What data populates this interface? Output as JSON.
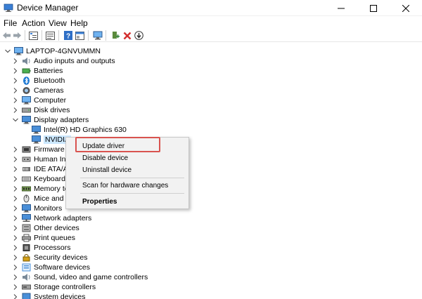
{
  "window": {
    "title": "Device Manager",
    "controls": {
      "minimize": "minimize-icon",
      "maximize": "maximize-icon",
      "close": "close-icon"
    }
  },
  "menu": {
    "items": [
      {
        "label": "File"
      },
      {
        "label": "Action"
      },
      {
        "label": "View"
      },
      {
        "label": "Help"
      }
    ]
  },
  "toolbar": {
    "buttons": [
      "back-arrow-icon",
      "forward-arrow-icon",
      "device-tree-icon",
      "properties-icon",
      "help-icon",
      "properties-sheet-icon",
      "monitor-scan-icon",
      "add-driver-icon",
      "remove-device-icon",
      "update-driver-icon"
    ]
  },
  "tree": {
    "root": "LAPTOP-4GNVUMMN",
    "categories": [
      {
        "label": "Audio inputs and outputs",
        "icon": "speaker-icon"
      },
      {
        "label": "Batteries",
        "icon": "battery-icon"
      },
      {
        "label": "Bluetooth",
        "icon": "bluetooth-icon"
      },
      {
        "label": "Cameras",
        "icon": "camera-icon"
      },
      {
        "label": "Computer",
        "icon": "computer-icon"
      },
      {
        "label": "Disk drives",
        "icon": "disk-drive-icon"
      },
      {
        "label": "Display adapters",
        "icon": "display-adapter-icon",
        "expanded": true,
        "children": [
          {
            "label": "Intel(R) HD Graphics 630",
            "icon": "display-adapter-icon"
          },
          {
            "label": "NVIDIA",
            "icon": "display-adapter-icon",
            "selected": true
          }
        ]
      },
      {
        "label": "Firmware",
        "icon": "firmware-icon"
      },
      {
        "label": "Human Int",
        "icon": "hid-icon"
      },
      {
        "label": "IDE ATA/ATA",
        "icon": "ide-controller-icon"
      },
      {
        "label": "Keyboards",
        "icon": "keyboard-icon"
      },
      {
        "label": "Memory te",
        "icon": "memory-icon"
      },
      {
        "label": "Mice and o",
        "icon": "mouse-icon"
      },
      {
        "label": "Monitors",
        "icon": "monitor-icon"
      },
      {
        "label": "Network adapters",
        "icon": "network-icon"
      },
      {
        "label": "Other devices",
        "icon": "other-device-icon"
      },
      {
        "label": "Print queues",
        "icon": "printer-icon"
      },
      {
        "label": "Processors",
        "icon": "processor-icon"
      },
      {
        "label": "Security devices",
        "icon": "security-icon"
      },
      {
        "label": "Software devices",
        "icon": "software-icon"
      },
      {
        "label": "Sound, video and game controllers",
        "icon": "sound-icon"
      },
      {
        "label": "Storage controllers",
        "icon": "storage-icon"
      },
      {
        "label": "System devices",
        "icon": "system-icon"
      }
    ]
  },
  "context_menu": {
    "items": [
      {
        "label": "Update driver",
        "highlighted": true
      },
      {
        "label": "Disable device"
      },
      {
        "label": "Uninstall device"
      },
      {
        "label": "Scan for hardware changes"
      },
      {
        "label": "Properties",
        "bold": true
      }
    ]
  },
  "colors": {
    "highlight_box": "#d9534f",
    "selection": "#cce8ff",
    "menu_bg": "#f2f2f2"
  }
}
